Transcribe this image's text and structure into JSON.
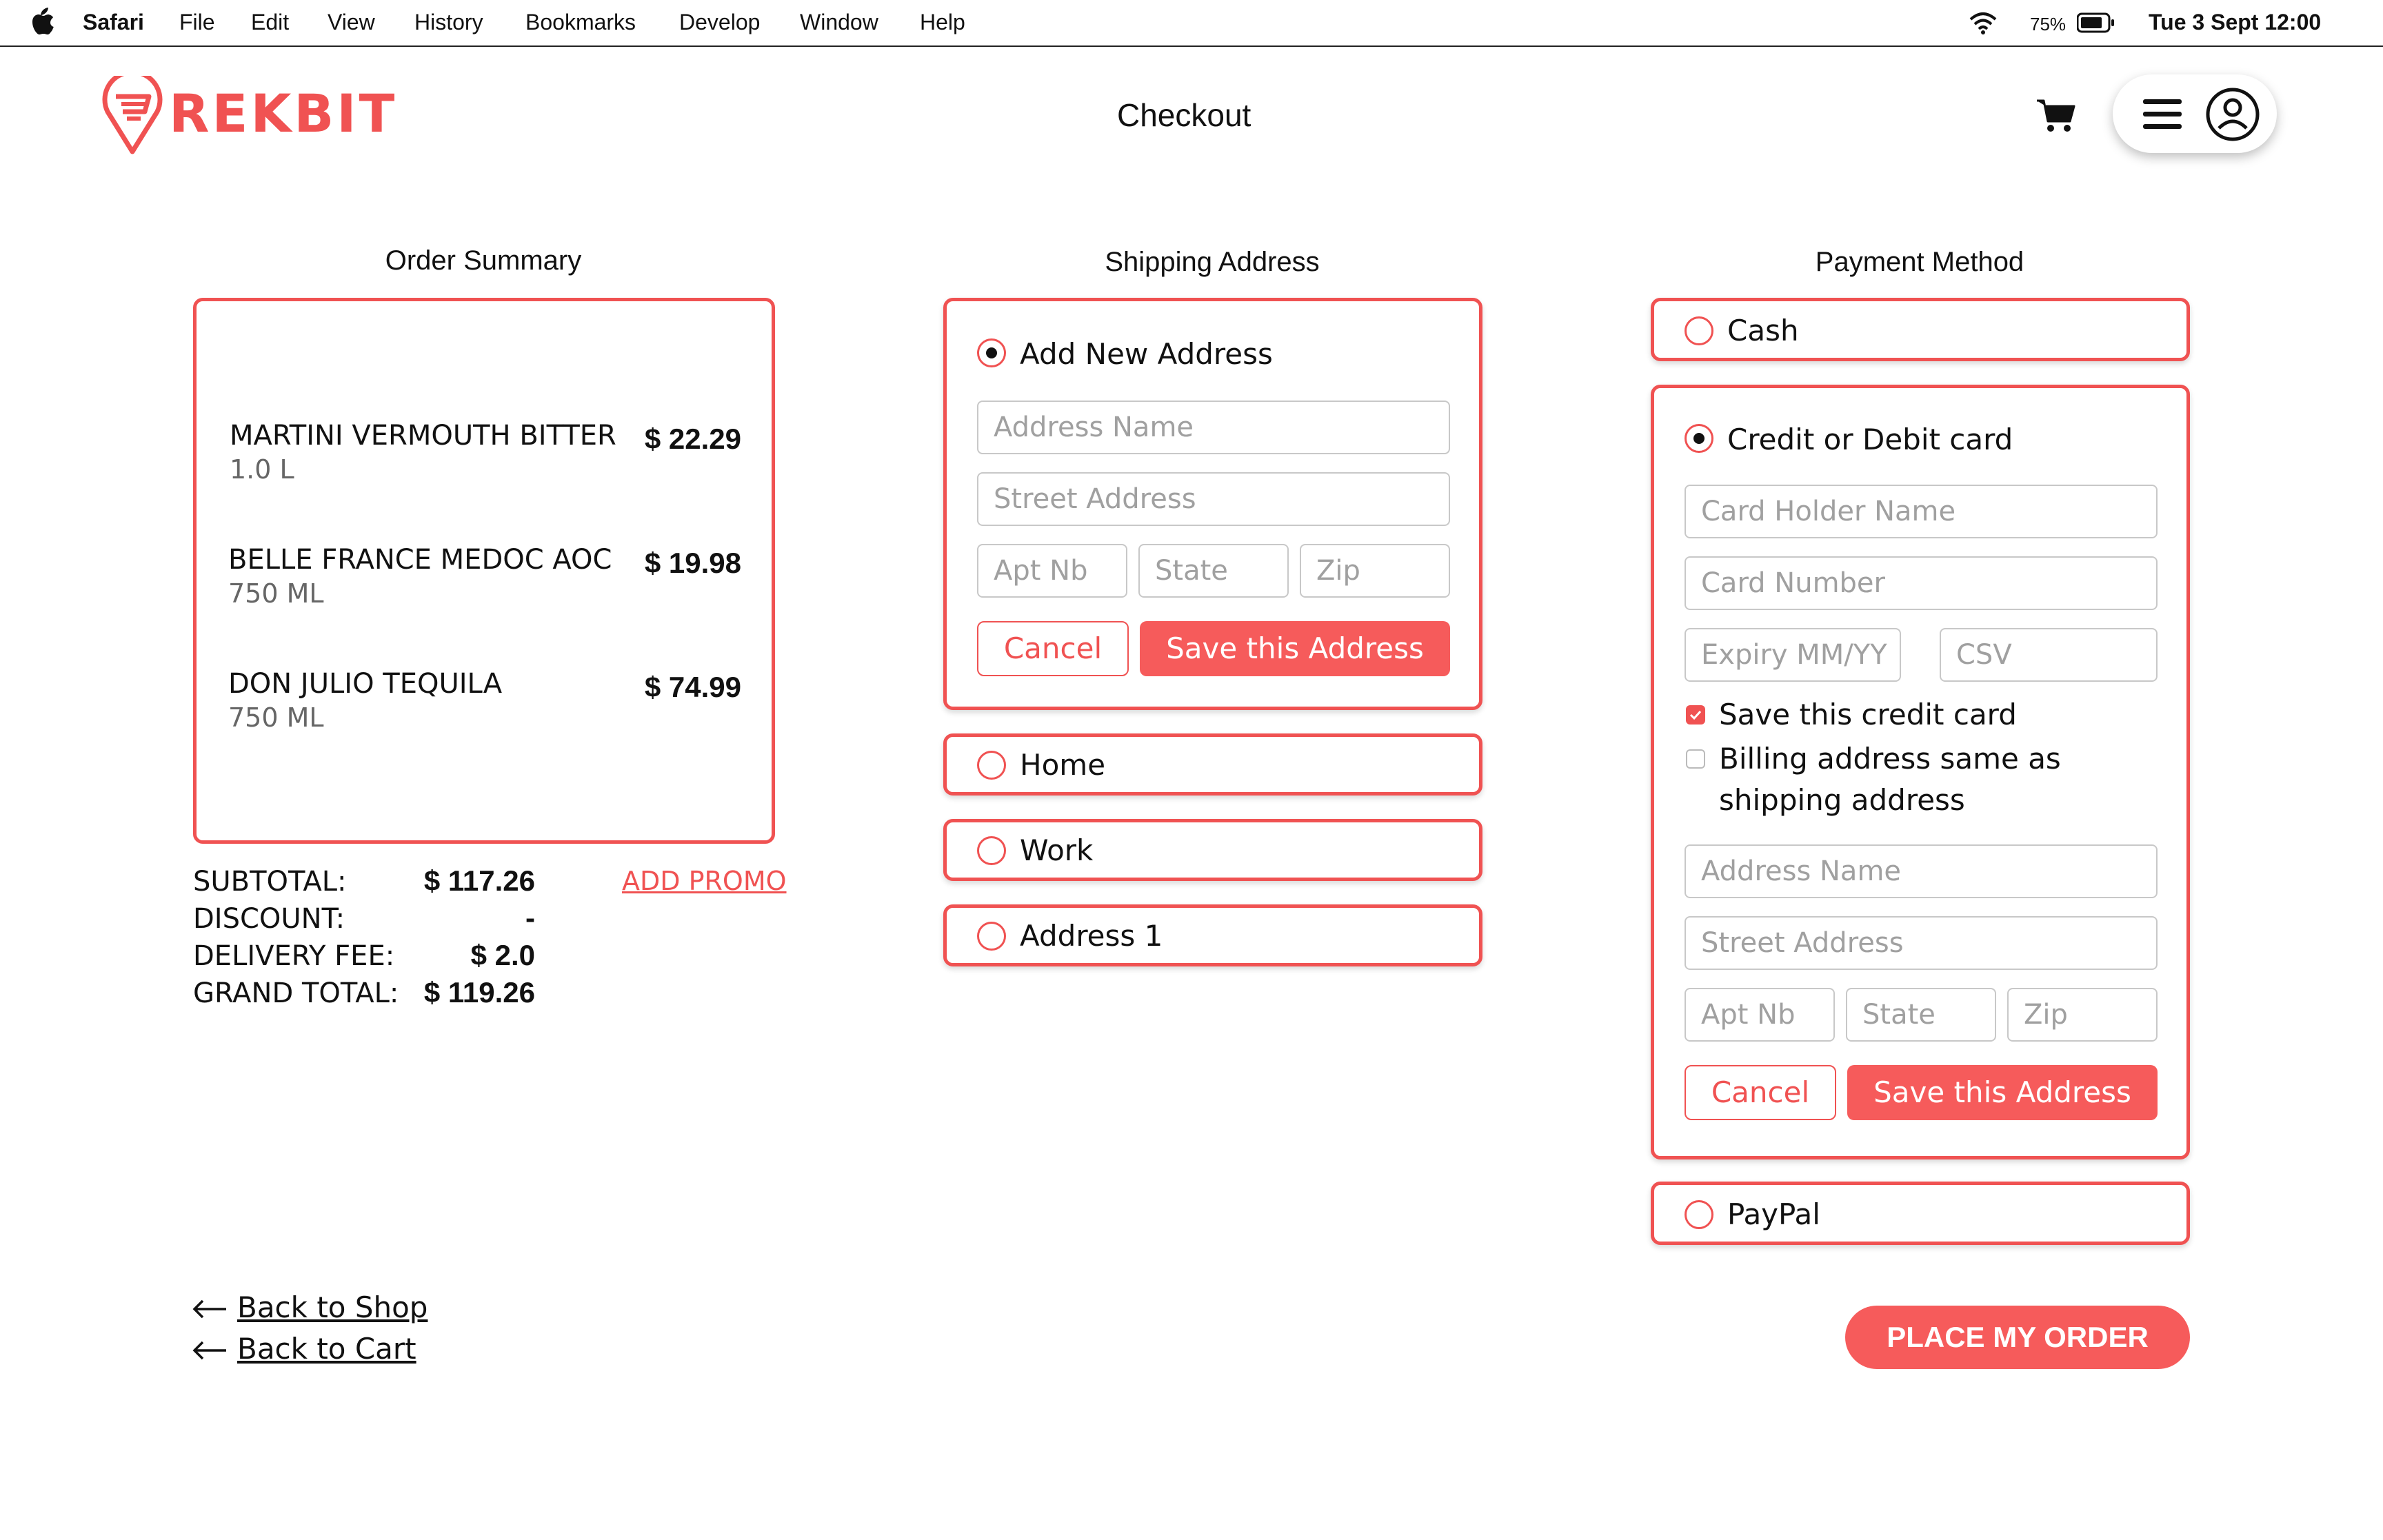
{
  "menubar": {
    "app": "Safari",
    "items": [
      "File",
      "Edit",
      "View",
      "History",
      "Bookmarks",
      "Develop",
      "Window",
      "Help"
    ],
    "battery": "75%",
    "datetime": "Tue 3 Sept  12:00"
  },
  "header": {
    "brand": "REKBIT",
    "title": "Checkout"
  },
  "order_summary": {
    "title": "Order Summary",
    "items": [
      {
        "name": "MARTINI VERMOUTH BITTER",
        "volume": "1.0 L",
        "price": "$ 22.29"
      },
      {
        "name": "BELLE FRANCE MEDOC AOC",
        "volume": "750 ML",
        "price": "$ 19.98"
      },
      {
        "name": "DON JULIO TEQUILA",
        "volume": "750 ML",
        "price": "$ 74.99"
      }
    ],
    "subtotal_label": "SUBTOTAL:",
    "subtotal": "$ 117.26",
    "discount_label": "DISCOUNT:",
    "discount": "-",
    "delivery_label": "DELIVERY FEE:",
    "delivery": "$ 2.0",
    "grand_label": "GRAND TOTAL:",
    "grand": "$ 119.26",
    "promo": "ADD PROMO"
  },
  "shipping": {
    "title": "Shipping Address",
    "new_address_label": "Add New Address",
    "placeholders": {
      "address_name": "Address Name",
      "street": "Street Address",
      "apt": "Apt Nb",
      "state": "State",
      "zip": "Zip"
    },
    "cancel": "Cancel",
    "save": "Save this Address",
    "saved": [
      "Home",
      "Work",
      "Address 1"
    ]
  },
  "payment": {
    "title": "Payment Method",
    "cash": "Cash",
    "card": "Credit or Debit card",
    "placeholders": {
      "holder": "Card Holder Name",
      "number": "Card Number",
      "expiry": "Expiry MM/YY",
      "csv": "CSV",
      "address_name": "Address Name",
      "street": "Street Address",
      "apt": "Apt Nb",
      "state": "State",
      "zip": "Zip"
    },
    "save_card": "Save this credit card",
    "billing_same": "Billing address same as shipping address",
    "cancel": "Cancel",
    "save": "Save this Address",
    "paypal": "PayPal"
  },
  "nav": {
    "back_shop": "Back to Shop",
    "back_cart": "Back to Cart",
    "place_order": "PLACE MY ORDER"
  },
  "colors": {
    "accent": "#f05252",
    "button": "#f65b5b"
  }
}
